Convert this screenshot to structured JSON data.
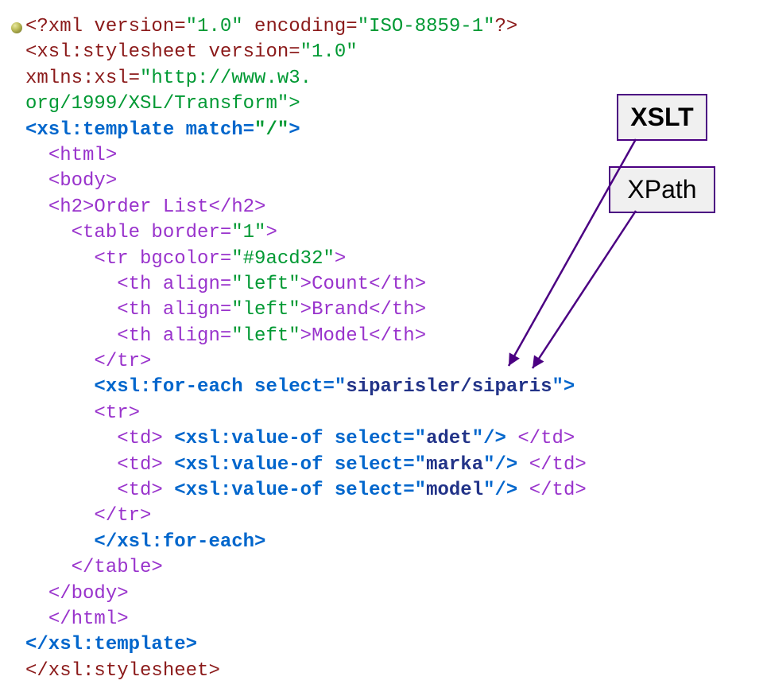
{
  "labels": {
    "xslt": "XSLT",
    "xpath": "XPath"
  },
  "code": {
    "l1a": "<?xml version=",
    "l1b": "\"1.0\"",
    "l1c": " encoding=",
    "l1d": "\"ISO-8859-1\"",
    "l1e": "?>",
    "l2a": "<xsl:stylesheet version=",
    "l2b": "\"1.0\"",
    "l3a": "xmlns:xsl=",
    "l3b": "\"http://www.w3.",
    "l4": "org/1999/XSL/Transform\">",
    "l5a": "<xsl:template match=",
    "l5b": "\"/\"",
    "l5c": ">",
    "l6": "<html>",
    "l7": "<body>",
    "l8": "<h2>Order List</h2>",
    "l9a": "<table border=",
    "l9b": "\"1\"",
    "l9c": ">",
    "l10a": "<tr bgcolor=",
    "l10b": "\"#9acd32\"",
    "l10c": ">",
    "l11a": "<th align=",
    "l11b": "\"left\"",
    "l11c": ">Count</th>",
    "l12a": "<th align=",
    "l12b": "\"left\"",
    "l12c": ">Brand</th>",
    "l13a": "<th align=",
    "l13b": "\"left\"",
    "l13c": ">Model</th>",
    "l14": "</tr>",
    "l15a": "<xsl:for-each select=\"",
    "l15b": "siparisler/siparis",
    "l15c": "\">",
    "l16": "<tr>",
    "l17a": "<td> ",
    "l17b": "<xsl:value-of select=\"",
    "l17c": "adet",
    "l17d": "\"/>",
    "l17e": " </td>",
    "l18a": "<td> ",
    "l18b": "<xsl:value-of select=\"",
    "l18c": "marka",
    "l18d": "\"/>",
    "l18e": " </td>",
    "l19a": "<td> ",
    "l19b": "<xsl:value-of select=\"",
    "l19c": "model",
    "l19d": "\"/>",
    "l19e": " </td>",
    "l20": "</tr>",
    "l21": "</xsl:for-each>",
    "l22": "</table>",
    "l23": "</body>",
    "l24": "</html>",
    "l25": "</xsl:template>",
    "l26": "</xsl:stylesheet>"
  }
}
